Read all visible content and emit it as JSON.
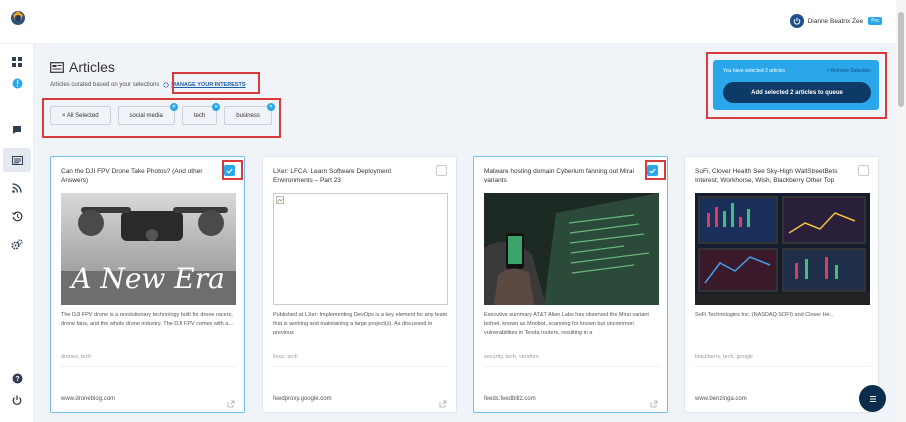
{
  "header": {
    "user_name": "Dianne Beatrix Zee",
    "pro_badge": "Pro"
  },
  "sidebar": {
    "items": [
      {
        "icon": "dashboard-grid-icon"
      },
      {
        "icon": "info-icon"
      },
      {
        "icon": "chat-icon"
      },
      {
        "icon": "articles-icon",
        "active": true
      },
      {
        "icon": "rss-icon"
      },
      {
        "icon": "history-icon"
      },
      {
        "icon": "settings-gears-icon"
      },
      {
        "icon": "help-icon"
      },
      {
        "icon": "logout-icon"
      }
    ]
  },
  "page": {
    "title": "Articles",
    "subtitle": "Articles curated based on your selections",
    "manage_link": "MANAGE YOUR INTERESTS"
  },
  "filters": {
    "chips": [
      {
        "label": "× All Selected",
        "removable": false
      },
      {
        "label": "social media",
        "removable": true
      },
      {
        "label": "tech",
        "removable": true
      },
      {
        "label": "business",
        "removable": true
      }
    ]
  },
  "selection": {
    "message": "You have selected 2 articles",
    "remove_label": "× Remove Selection",
    "add_button": "Add selected 2 articles to queue"
  },
  "articles": [
    {
      "title": "Can the DJI FPV Drone Take Photos? (And other Answers)",
      "selected": true,
      "image": "drone",
      "description": "The DJI FPV drone is a revolutionary technology built for drone racers, drone fans, and the whole drone industry. The DJI FPV comes with a...",
      "tags": "drones, tech",
      "domain": "www.droneblog.com"
    },
    {
      "title": "LXer: LFCA: Learn Software Deployment Environments – Part 23",
      "selected": false,
      "image": "broken",
      "description": "Published at LXer: Implementing DevOps is a key element for any team that is working and maintaining a large project(s). As discussed in previous",
      "tags": "linux, tech",
      "domain": "feedproxy.google.com"
    },
    {
      "title": "Malware hosting domain Cyberium fanning out Mirai variants",
      "selected": true,
      "image": "malware",
      "description": "Executive summary AT&T Alien Labs has observed the Mirai variant botnet, known as Moobot, scanning for known but uncommon vulnerabilities in Tenda routers, resulting in a",
      "tags": "security, tech, vendors",
      "domain": "feeds.feedblitz.com"
    },
    {
      "title": "SoFi, Clover Health See Sky-High WallStreetBets Interest; Workhorse, Wish, Blackberry Other Top",
      "selected": false,
      "image": "trading",
      "description": "SoFi Technologies Inc. (NASDAQ:SOFI) and Clover He...",
      "tags": "blackberry, tech, google",
      "domain": "www.benzinga.com"
    }
  ],
  "drone_image_text": "A New Era",
  "colors": {
    "accent": "#2aa7ea",
    "navy": "#0d3a66",
    "highlight": "#d93a3a",
    "background": "#f0f3f7"
  }
}
